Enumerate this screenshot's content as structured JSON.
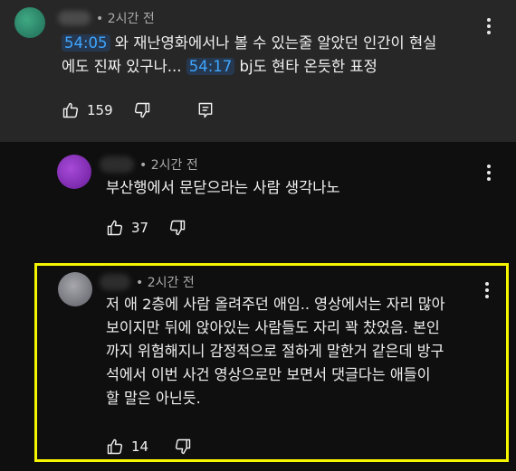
{
  "comments": [
    {
      "avatar_color": "#2f8a6e",
      "time": "• 2시간 전",
      "text_parts": [
        "54:05",
        " 와 재난영화에서나 볼 수 있는줄 알았던 인간이 현실",
        "에도 진짜 있구나... ",
        "54:17",
        " bj도 현타 온듯한 표정"
      ],
      "likes": "159"
    },
    {
      "avatar_color": "#8a2cc0",
      "time": "• 2시간 전",
      "text": "부산행에서 문닫으라는 사람 생각나노",
      "likes": "37"
    },
    {
      "avatar_color": "#8c8c94",
      "time": "• 2시간 전",
      "lines": [
        "저 애 2층에 사람 올려주던 애임.. 영상에서는 자리 많아",
        "보이지만 뒤에 앉아있는 사람들도 자리 꽉 찼었음. 본인",
        "까지 위험해지니 감정적으로 절하게 말한거 같은데 방구",
        "석에서 이번 사건 영상으로만 보면서 댓글다는 애들이",
        "할 말은 아닌듯."
      ],
      "likes": "14"
    }
  ],
  "icons": [
    "thumbs-up-icon",
    "thumbs-down-icon",
    "reply-icon",
    "more-vert-icon"
  ],
  "highlight_color": "#f5f500"
}
